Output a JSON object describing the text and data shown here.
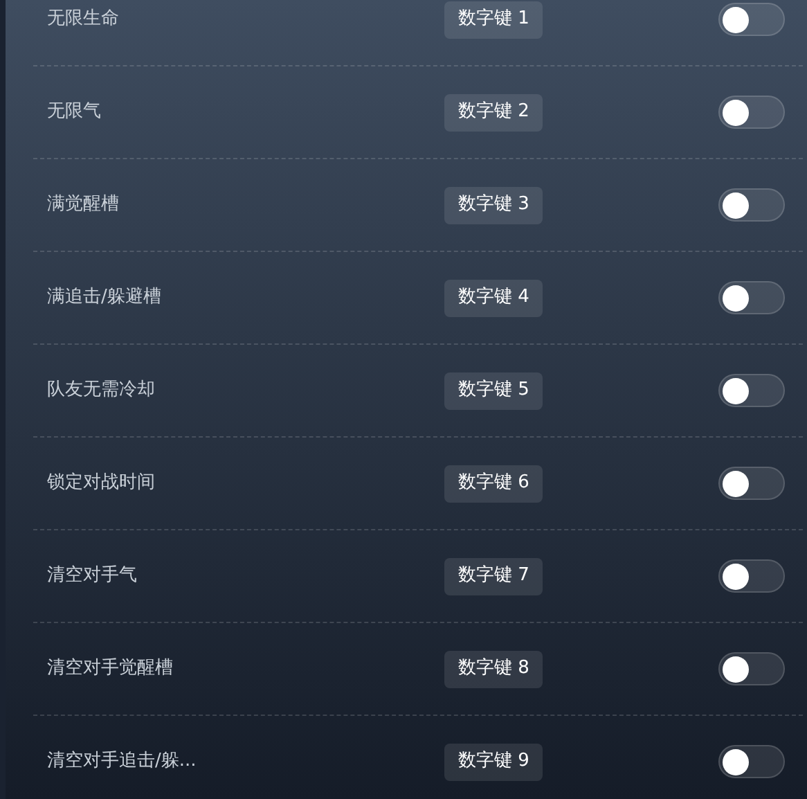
{
  "options": [
    {
      "label": "无限生命",
      "hotkey": "数字键 1",
      "on": false
    },
    {
      "label": "无限气",
      "hotkey": "数字键 2",
      "on": false
    },
    {
      "label": "满觉醒槽",
      "hotkey": "数字键 3",
      "on": false
    },
    {
      "label": "满追击/躲避槽",
      "hotkey": "数字键 4",
      "on": false
    },
    {
      "label": "队友无需冷却",
      "hotkey": "数字键 5",
      "on": false
    },
    {
      "label": "锁定对战时间",
      "hotkey": "数字键 6",
      "on": false
    },
    {
      "label": "清空对手气",
      "hotkey": "数字键 7",
      "on": false
    },
    {
      "label": "清空对手觉醒槽",
      "hotkey": "数字键 8",
      "on": false
    },
    {
      "label": "清空对手追击/躲...",
      "hotkey": "数字键 9",
      "on": false
    }
  ]
}
